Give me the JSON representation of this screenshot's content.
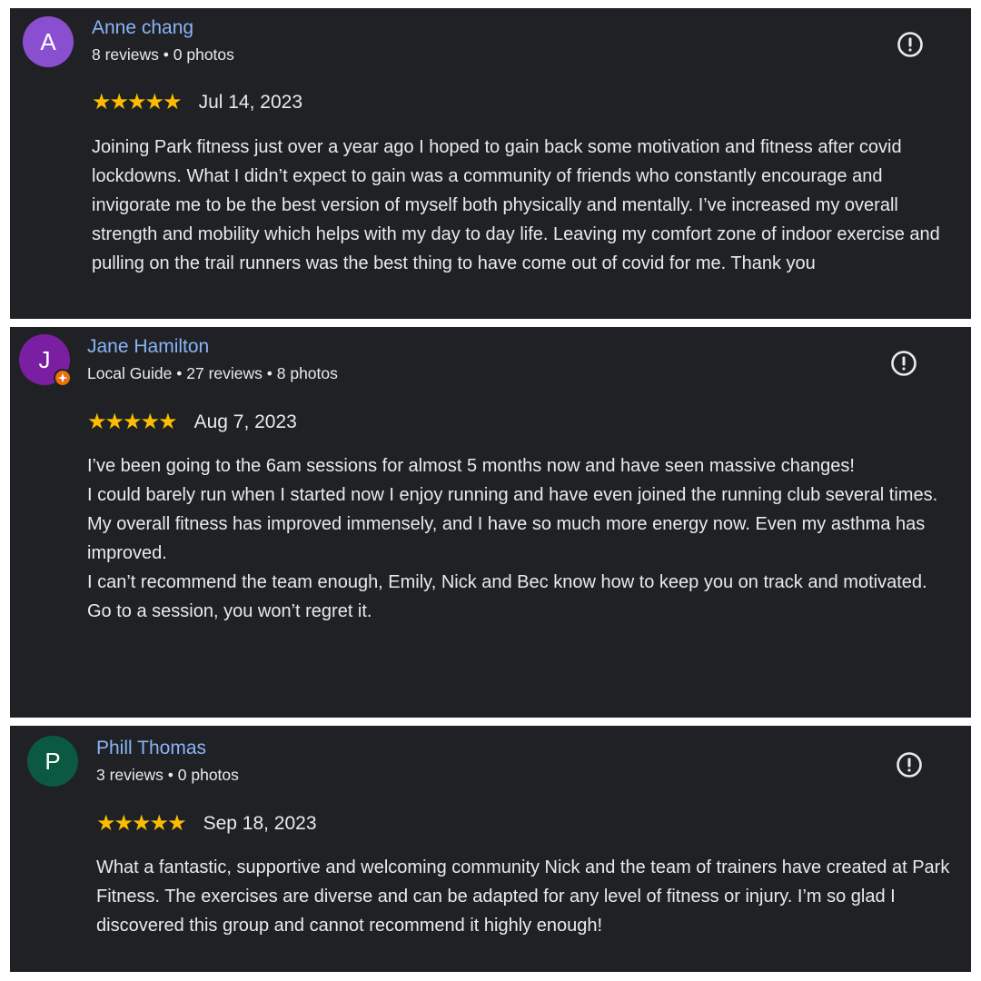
{
  "reviews": [
    {
      "avatar_letter": "A",
      "avatar_color": "#8a4fd0",
      "name": "Anne chang",
      "meta": "8 reviews • 0 photos",
      "stars": "★★★★★",
      "rating": 5,
      "date": "Jul 14, 2023",
      "text": [
        "Joining Park fitness just over a year ago I hoped to gain back some motivation and fitness after covid lockdowns. What I didn’t expect to gain was a community of friends who constantly encourage and invigorate me to be the best version of myself both physically and mentally. I’ve increased my overall strength and mobility which helps with my day to day life. Leaving my comfort zone of indoor exercise and pulling on the trail runners was the best thing to have come out of covid for me. Thank you"
      ]
    },
    {
      "avatar_letter": "J",
      "avatar_color": "#7b1fa2",
      "name": "Jane Hamilton",
      "meta": "Local Guide • 27 reviews • 8 photos",
      "stars": "★★★★★",
      "rating": 5,
      "date": "Aug 7, 2023",
      "text": [
        "I’ve been going to the 6am sessions for almost 5 months now and have seen massive changes!",
        "I could barely run when I started now I enjoy running and have even joined the running club several times.",
        "My overall fitness has improved immensely, and I have so much more energy now. Even my asthma has improved.",
        "I can’t recommend the team enough, Emily, Nick and Bec know how to keep you on track and motivated.",
        "Go to a session, you won’t regret it."
      ]
    },
    {
      "avatar_letter": "P",
      "avatar_color": "#0b5940",
      "name": "Phill Thomas",
      "meta": "3 reviews • 0 photos",
      "stars": "★★★★★",
      "rating": 5,
      "date": "Sep 18, 2023",
      "text": [
        "What a fantastic, supportive and welcoming community Nick and the team of trainers have created at Park Fitness. The exercises are diverse and can be adapted for any level of fitness or injury. I’m so glad I discovered this group and cannot recommend it highly enough!"
      ]
    }
  ],
  "colors": {
    "card_bg": "#202124",
    "name": "#8ab4f8",
    "text": "#e8eaed",
    "star": "#fbbc04",
    "guide_badge": "#e8710a"
  }
}
